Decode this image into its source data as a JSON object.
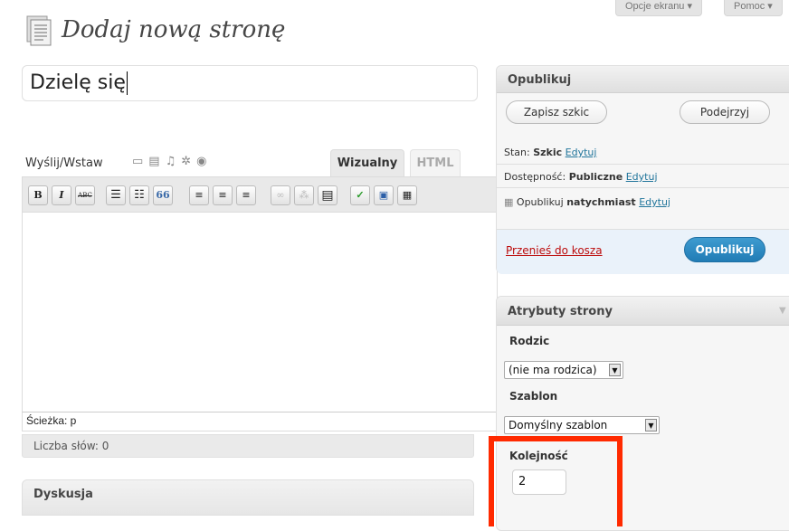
{
  "screen_meta": {
    "options": "Opcje ekranu",
    "help": "Pomoc"
  },
  "page": {
    "title": "Dodaj nową stronę"
  },
  "post": {
    "title_value": "Dzielę się"
  },
  "editor": {
    "upload_label": "Wyślij/Wstaw",
    "tab_visual": "Wizualny",
    "tab_html": "HTML",
    "path_label": "Ścieżka: p",
    "word_count": "Liczba słów: 0",
    "toolbar": {
      "bold": "B",
      "italic": "I",
      "strike": "ABC",
      "quote": "66"
    }
  },
  "discussion": {
    "title": "Dyskusja"
  },
  "publish": {
    "title": "Opublikuj",
    "save_draft": "Zapisz szkic",
    "preview": "Podejrzyj",
    "status_label": "Stan:",
    "status_value": "Szkic",
    "visibility_label": "Dostępność:",
    "visibility_value": "Publiczne",
    "publish_label": "Opublikuj",
    "publish_value": "natychmiast",
    "edit": "Edytuj",
    "trash": "Przenieś do kosza",
    "publish_button": "Opublikuj"
  },
  "attributes": {
    "title": "Atrybuty strony",
    "parent_label": "Rodzic",
    "parent_value": "(nie ma rodzica)",
    "template_label": "Szablon",
    "template_value": "Domyślny szablon",
    "order_label": "Kolejność",
    "order_value": "2"
  },
  "colors": {
    "link": "#21759b",
    "primary": "#2a8bc6",
    "trash": "#bc0b0b",
    "highlight": "#ff2a00"
  }
}
